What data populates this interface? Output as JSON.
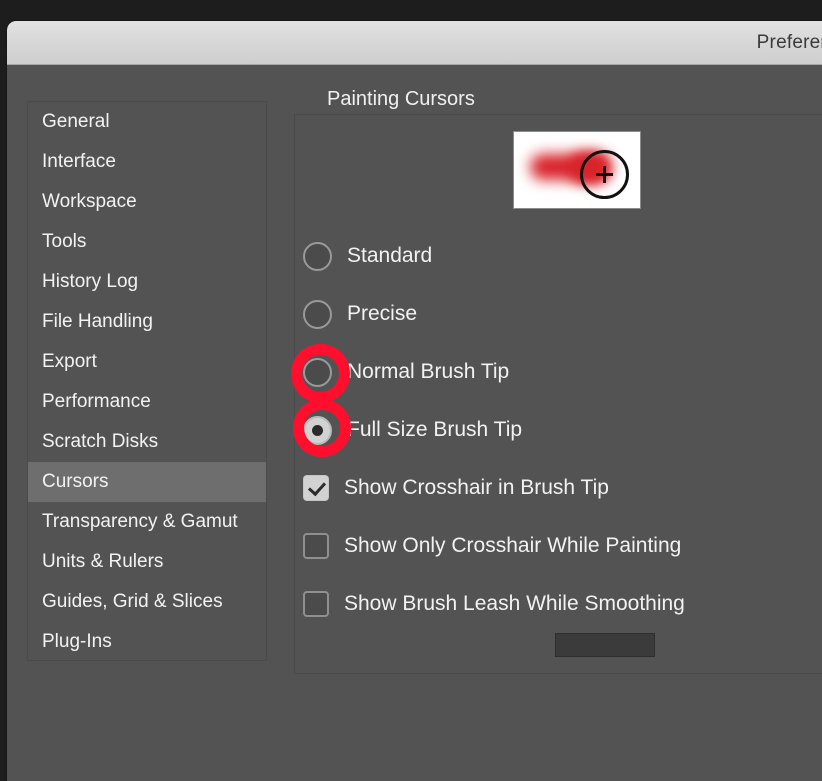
{
  "window": {
    "title": "Preferences"
  },
  "sidebar": {
    "items": [
      {
        "label": "General",
        "selected": false
      },
      {
        "label": "Interface",
        "selected": false
      },
      {
        "label": "Workspace",
        "selected": false
      },
      {
        "label": "Tools",
        "selected": false
      },
      {
        "label": "History Log",
        "selected": false
      },
      {
        "label": "File Handling",
        "selected": false
      },
      {
        "label": "Export",
        "selected": false
      },
      {
        "label": "Performance",
        "selected": false
      },
      {
        "label": "Scratch Disks",
        "selected": false
      },
      {
        "label": "Cursors",
        "selected": true
      },
      {
        "label": "Transparency & Gamut",
        "selected": false
      },
      {
        "label": "Units & Rulers",
        "selected": false
      },
      {
        "label": "Guides, Grid & Slices",
        "selected": false
      },
      {
        "label": "Plug-Ins",
        "selected": false
      }
    ]
  },
  "painting_cursors": {
    "legend": "Painting Cursors",
    "preview": {
      "stroke_color": "#d8232a",
      "cursor_color": "#111111",
      "background": "#ffffff"
    },
    "radios": [
      {
        "label": "Standard",
        "checked": false,
        "annotated": false
      },
      {
        "label": "Precise",
        "checked": false,
        "annotated": false
      },
      {
        "label": "Normal Brush Tip",
        "checked": false,
        "annotated": true
      },
      {
        "label": "Full Size Brush Tip",
        "checked": true,
        "annotated": true
      }
    ],
    "checkboxes": [
      {
        "label": "Show Crosshair in Brush Tip",
        "checked": true
      },
      {
        "label": "Show Only Crosshair While Painting",
        "checked": false
      },
      {
        "label": "Show Brush Leash While Smoothing",
        "checked": false
      }
    ]
  },
  "annotation": {
    "color": "#ff0f2e"
  }
}
